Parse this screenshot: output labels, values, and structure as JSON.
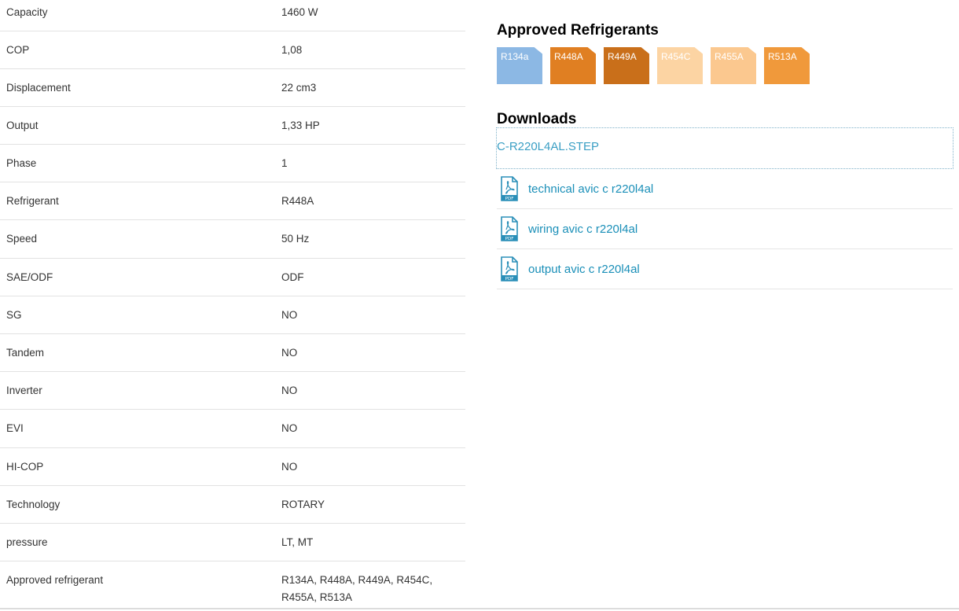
{
  "specs": [
    {
      "label": "Capacity",
      "value": "1460 W"
    },
    {
      "label": "COP",
      "value": "1,08"
    },
    {
      "label": "Displacement",
      "value": "22 cm3"
    },
    {
      "label": "Output",
      "value": "1,33 HP"
    },
    {
      "label": "Phase",
      "value": "1"
    },
    {
      "label": "Refrigerant",
      "value": "R448A"
    },
    {
      "label": "Speed",
      "value": "50 Hz"
    },
    {
      "label": "SAE/ODF",
      "value": "ODF"
    },
    {
      "label": "SG",
      "value": "NO"
    },
    {
      "label": "Tandem",
      "value": "NO"
    },
    {
      "label": "Inverter",
      "value": "NO"
    },
    {
      "label": "EVI",
      "value": "NO"
    },
    {
      "label": "HI-COP",
      "value": "NO"
    },
    {
      "label": "Technology",
      "value": "ROTARY"
    },
    {
      "label": "pressure",
      "value": "LT, MT"
    },
    {
      "label": "Approved refrigerant",
      "value": "R134A, R448A, R449A, R454C, R455A, R513A"
    }
  ],
  "refrigerants": {
    "title": "Approved Refrigerants",
    "chips": [
      {
        "label": "R134a",
        "color": "#8cb8e4"
      },
      {
        "label": "R448A",
        "color": "#e07f22"
      },
      {
        "label": "R449A",
        "color": "#c96f1a"
      },
      {
        "label": "R454C",
        "color": "#fcd4a3"
      },
      {
        "label": "R455A",
        "color": "#fbc88f"
      },
      {
        "label": "R513A",
        "color": "#f0993b"
      }
    ]
  },
  "downloads": {
    "title": "Downloads",
    "step_file": "C-R220L4AL.STEP",
    "items": [
      {
        "label": "technical avic c r220l4al",
        "icon": "pdf-icon"
      },
      {
        "label": "wiring avic c r220l4al",
        "icon": "pdf-icon"
      },
      {
        "label": "output avic c r220l4al",
        "icon": "pdf-icon"
      }
    ]
  }
}
